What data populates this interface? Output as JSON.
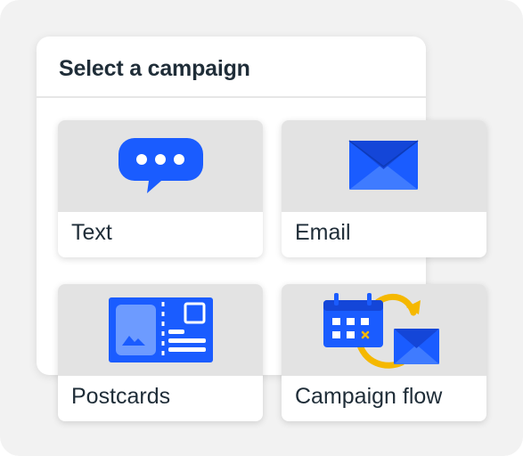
{
  "panel": {
    "title": "Select a campaign"
  },
  "cards": [
    {
      "id": "text",
      "label": "Text",
      "icon": "chat-bubble-icon"
    },
    {
      "id": "email",
      "label": "Email",
      "icon": "envelope-icon"
    },
    {
      "id": "postcards",
      "label": "Postcards",
      "icon": "postcard-icon"
    },
    {
      "id": "campaign-flow",
      "label": "Campaign flow",
      "icon": "campaign-flow-icon"
    }
  ],
  "colors": {
    "primary_blue": "#1a5cff",
    "dark_blue": "#0f3fbf",
    "accent_yellow": "#f5b800",
    "title_text": "#1f2d38",
    "card_media_bg": "#e3e3e3",
    "background": "#f2f2f2"
  }
}
